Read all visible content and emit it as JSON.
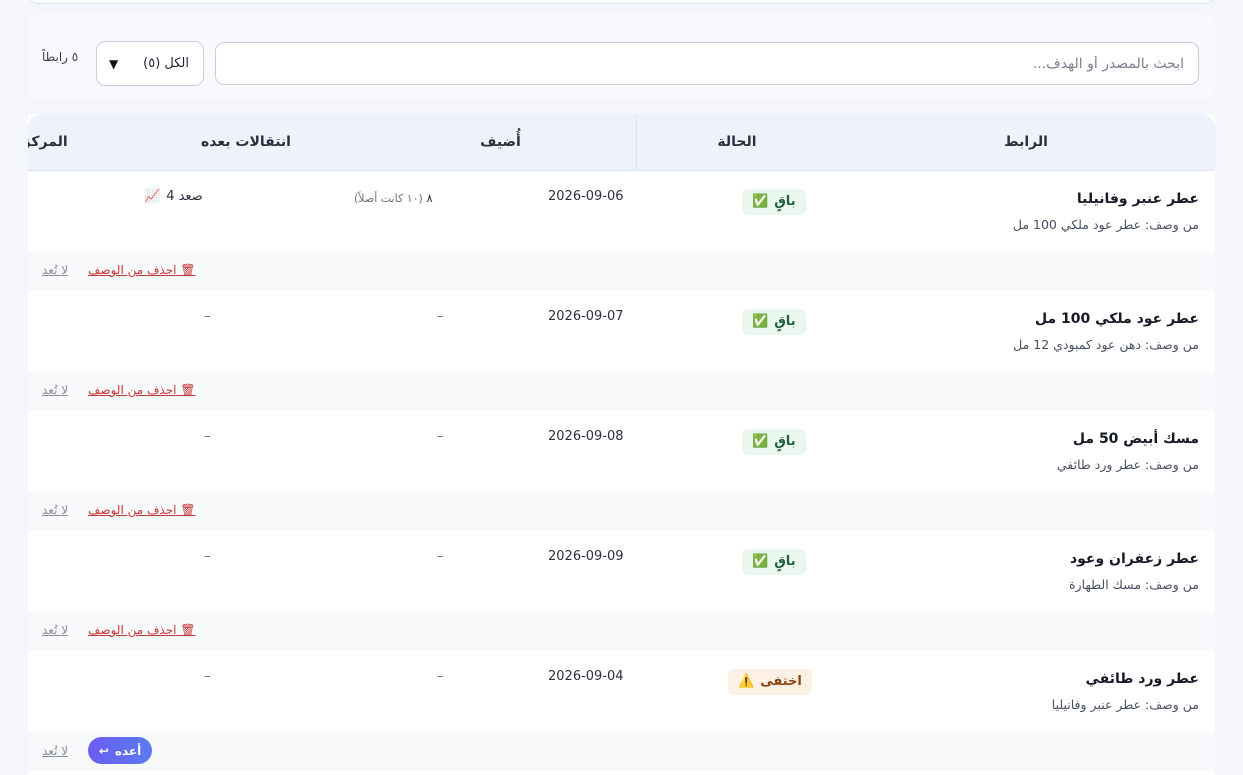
{
  "toolbar": {
    "search_placeholder": "ابحث بالمصدر أو الهدف...",
    "filter_selected": "الكل (٥)",
    "count_label": "٥ رابطاً"
  },
  "table": {
    "headers": {
      "link": "الرابط",
      "status": "الحالة",
      "added": "أُضيف",
      "moves": "انتقالات بعده",
      "rank": "المركز بعده"
    },
    "rows": [
      {
        "title": "عطر عنبر وفانيليا",
        "desc": "من وصف: عطر عود ملكي 100 مل",
        "status": "باقٍ",
        "status_icon": "✅",
        "date": "2026-09-06",
        "moves_value": "٨",
        "moves_note": "(١٠ كانت أصلاً)",
        "rank_text": "صعد 4",
        "rank_icon": "📈",
        "remove_label": "🗑 احذف من الوصف",
        "undo_label": "لا تُعد"
      },
      {
        "title": "عطر عود ملكي 100 مل",
        "desc": "من وصف: دهن عود كمبودي 12 مل",
        "status": "باقٍ",
        "status_icon": "✅",
        "date": "2026-09-07",
        "moves_dash": "–",
        "rank_dash": "–",
        "remove_label": "🗑 احذف من الوصف",
        "undo_label": "لا تُعد"
      },
      {
        "title": "مسك أبيض 50 مل",
        "desc": "من وصف: عطر ورد طائفي",
        "status": "باقٍ",
        "status_icon": "✅",
        "date": "2026-09-08",
        "moves_dash": "–",
        "rank_dash": "–",
        "remove_label": "🗑 احذف من الوصف",
        "undo_label": "لا تُعد"
      },
      {
        "title": "عطر زعفران وعود",
        "desc": "من وصف: مسك الطهارة",
        "status": "باقٍ",
        "status_icon": "✅",
        "date": "2026-09-09",
        "moves_dash": "–",
        "rank_dash": "–",
        "remove_label": "🗑 احذف من الوصف",
        "undo_label": "لا تُعد"
      },
      {
        "title": "عطر ورد طائفي",
        "desc": "من وصف: عطر عنبر وفانيليا",
        "status": "اختفى",
        "status_icon": "⚠️",
        "date": "2026-09-04",
        "moves_dash": "–",
        "rank_dash": "–",
        "restore_label": "أعده",
        "restore_icon": "↩",
        "undo_label": "لا تُعد"
      }
    ]
  },
  "colors": {
    "accent": "#6a5cf2",
    "danger": "#c6373a",
    "ok_badge_bg": "#eaf7ef",
    "warn_badge_bg": "#fdf1e5"
  }
}
